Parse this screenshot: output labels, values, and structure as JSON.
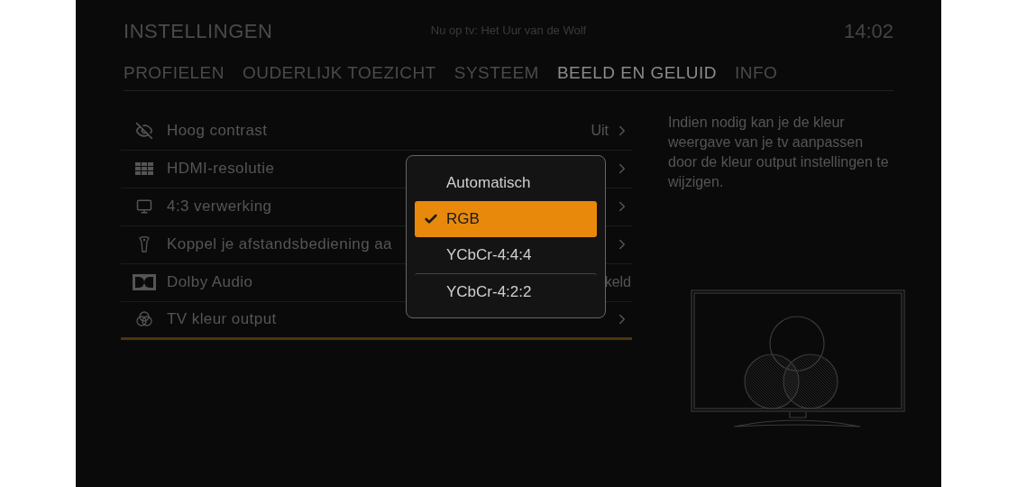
{
  "header": {
    "title": "INSTELLINGEN",
    "now_playing": "Nu op tv: Het Uur van de Wolf",
    "clock": "14:02"
  },
  "tabs": [
    {
      "label": "PROFIELEN",
      "selected": false
    },
    {
      "label": "OUDERLIJK TOEZICHT",
      "selected": false
    },
    {
      "label": "SYSTEEM",
      "selected": false
    },
    {
      "label": "BEELD EN GELUID",
      "selected": true
    },
    {
      "label": "INFO",
      "selected": false
    }
  ],
  "settings": [
    {
      "label": "Hoog contrast",
      "value": "Uit",
      "selected": false,
      "arrow": true
    },
    {
      "label": "HDMI-resolutie",
      "selected": false,
      "arrow": true
    },
    {
      "label": "4:3 verwerking",
      "selected": false,
      "arrow": true
    },
    {
      "label": "Koppel je afstandsbediening aa",
      "selected": false,
      "arrow": true
    },
    {
      "label": "Dolby Audio",
      "value": "keld",
      "selected": false,
      "arrow": false
    },
    {
      "label": "TV kleur output",
      "selected": true,
      "arrow": true
    }
  ],
  "description": "Indien nodig kan je de kleur weergave van je tv aanpassen door de kleur output instellingen te wijzigen.",
  "popup": {
    "options": [
      {
        "label": "Automatisch",
        "selected": false,
        "separator": false
      },
      {
        "label": "RGB",
        "selected": true,
        "separator": false
      },
      {
        "label": "YCbCr-4:4:4",
        "selected": false,
        "separator": false
      },
      {
        "label": "YCbCr-4:2:2",
        "selected": false,
        "separator": true
      }
    ]
  }
}
